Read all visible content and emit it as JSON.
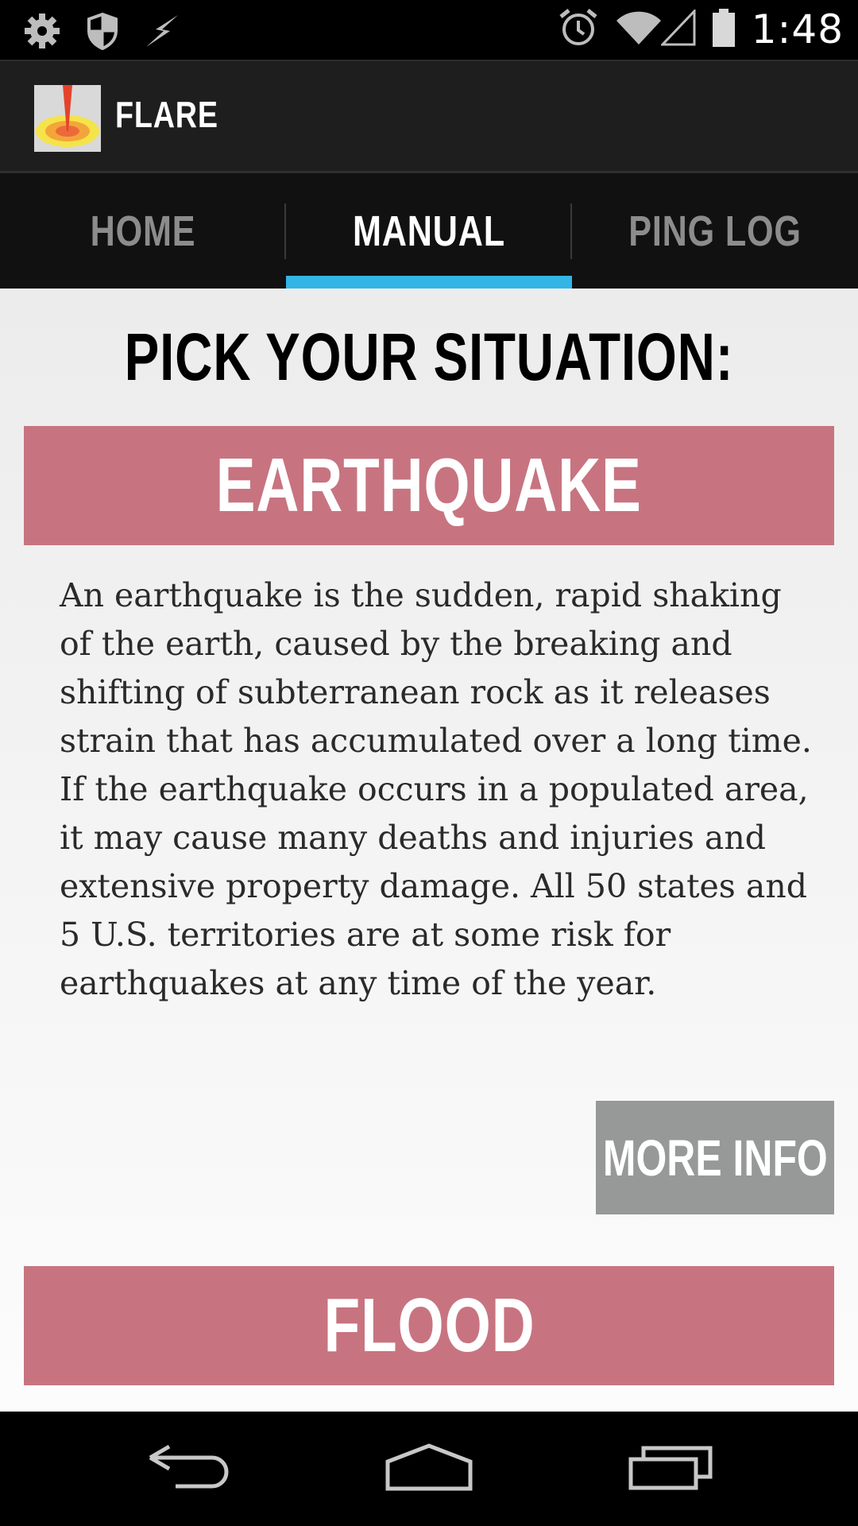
{
  "status_bar": {
    "time": "1:48",
    "left_icons": [
      "settings-icon",
      "shield-icon",
      "bolt-icon"
    ],
    "right_icons": [
      "alarm-icon",
      "wifi-icon",
      "signal-icon",
      "battery-icon"
    ]
  },
  "app": {
    "title": "FLARE",
    "icon": "flare-logo"
  },
  "tabs": [
    {
      "label": "HOME",
      "active": false
    },
    {
      "label": "MANUAL",
      "active": true
    },
    {
      "label": "PING LOG",
      "active": false
    }
  ],
  "main": {
    "page_title": "PICK YOUR SITUATION:",
    "situations": [
      {
        "label": "EARTHQUAKE",
        "description": "An earthquake is the sudden, rapid shaking of the earth, caused by the breaking and shifting of subterranean rock as it releases strain that has accumulated over a long time.  If the earthquake occurs in a populated area, it may cause many deaths and injuries and extensive property damage.  All 50 states and 5 U.S. territories are at some risk for earthquakes at any time of the year.",
        "more_info_label": "MORE INFO"
      },
      {
        "label": "FLOOD"
      }
    ]
  },
  "nav_bar": {
    "buttons": [
      "back-icon",
      "home-icon",
      "recents-icon"
    ]
  },
  "colors": {
    "accent": "#33b5e5",
    "situation_bg": "#c77480",
    "more_info_bg": "#979898",
    "tab_bar_bg": "#111111",
    "action_bar_bg": "#1e1e1e"
  }
}
